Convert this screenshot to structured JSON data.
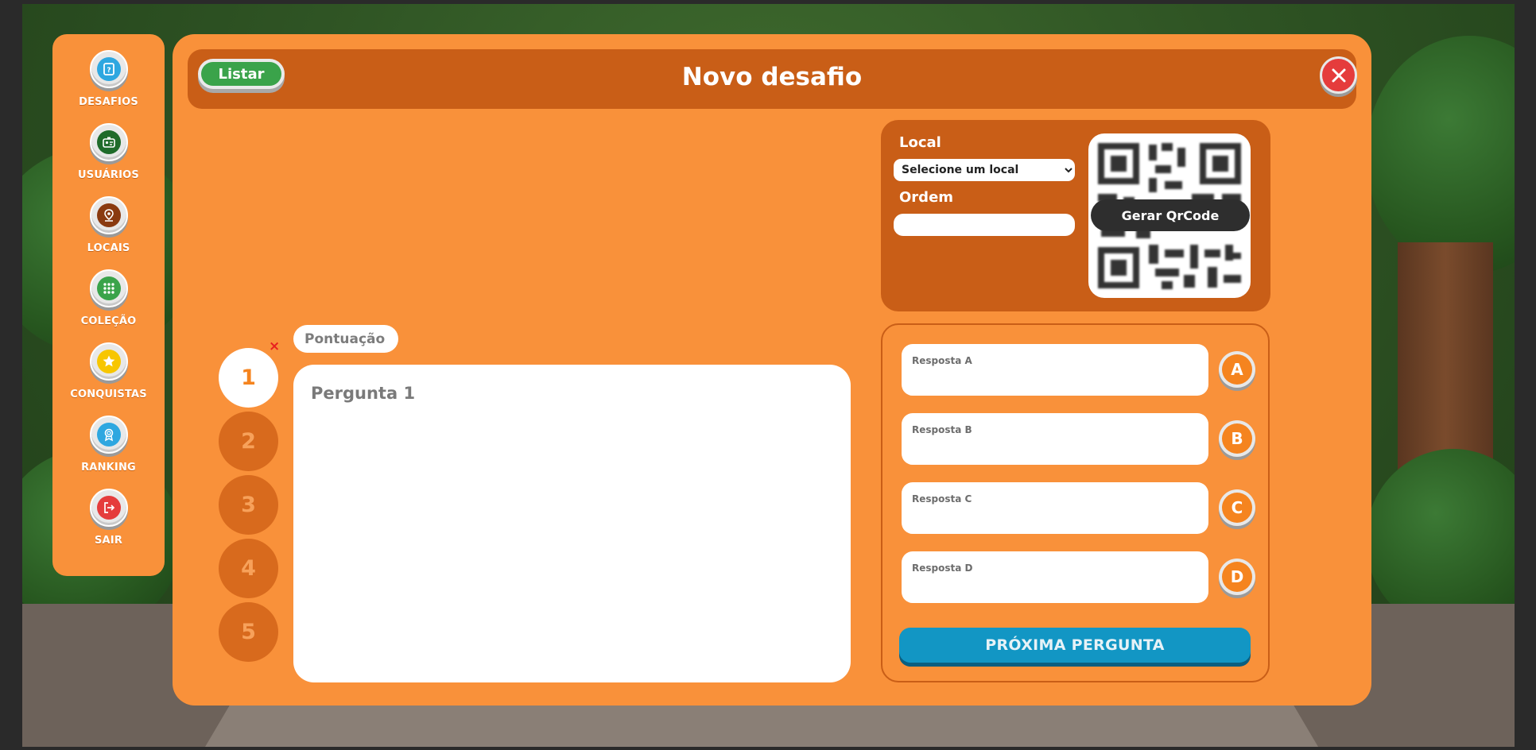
{
  "sidebar": {
    "items": [
      {
        "label": "DESAFIOS",
        "icon": "challenges-icon",
        "color": "#2ea7e0"
      },
      {
        "label": "USUÁRIOS",
        "icon": "user-card-icon",
        "color": "#1f6b2a"
      },
      {
        "label": "LOCAIS",
        "icon": "location-pin-icon",
        "color": "#8a3a10"
      },
      {
        "label": "COLEÇÃO",
        "icon": "grid-icon",
        "color": "#3aa34a"
      },
      {
        "label": "CONQUISTAS",
        "icon": "star-icon",
        "color": "#f7c600"
      },
      {
        "label": "RANKING",
        "icon": "badge-icon",
        "color": "#2ea7e0"
      },
      {
        "label": "SAIR",
        "icon": "logout-icon",
        "color": "#e53c3c"
      }
    ]
  },
  "modal": {
    "title": "Novo desafio",
    "list_button": "Listar",
    "close_icon": "close-icon"
  },
  "local_panel": {
    "local_label": "Local",
    "local_select": "Selecione um local",
    "ordem_label": "Ordem",
    "ordem_value": "",
    "qr_button": "Gerar QrCode"
  },
  "question": {
    "score_placeholder": "Pontuação",
    "text_placeholder": "Pergunta 1",
    "numbers": [
      "1",
      "2",
      "3",
      "4",
      "5"
    ],
    "active": "1",
    "remove_mark": "×"
  },
  "answers": {
    "items": [
      {
        "placeholder": "Resposta A",
        "letter": "A"
      },
      {
        "placeholder": "Resposta B",
        "letter": "B"
      },
      {
        "placeholder": "Resposta C",
        "letter": "C"
      },
      {
        "placeholder": "Resposta D",
        "letter": "D"
      }
    ],
    "next_button": "PRÓXIMA PERGUNTA"
  },
  "colors": {
    "panel_orange": "#f9913a",
    "dark_orange": "#c95e17",
    "next_blue": "#1296c4"
  }
}
